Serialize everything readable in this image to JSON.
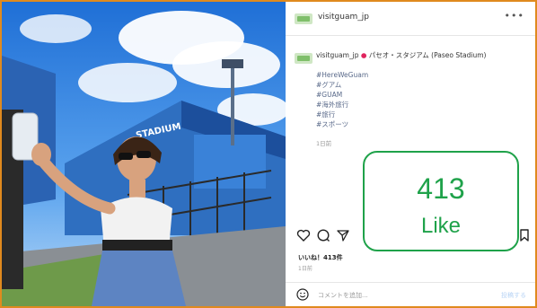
{
  "post": {
    "username": "visitguam_jp",
    "more_icon": "ellipsis-icon",
    "caption_user": "visitguam_jp",
    "caption_location": "パセオ・スタジアム (Paseo Stadium)",
    "hashtags": [
      "#HereWeGuam",
      "#グアム",
      "#GUAM",
      "#海外旅行",
      "#旅行",
      "#スポーツ"
    ],
    "time_ago": "1日前",
    "photo_sign": "STADIUM",
    "likes_text": "いいね！413件",
    "date_text": "1日前",
    "comment_placeholder": "コメントを追加...",
    "post_button": "投稿する"
  },
  "overlay": {
    "like_count": "413",
    "like_label": "Like",
    "accent_color": "#1fa24a"
  },
  "icons": [
    "heart-icon",
    "comment-icon",
    "share-icon",
    "bookmark-icon",
    "emoji-icon"
  ],
  "colors": {
    "frame": "#e08a1e",
    "stadium_blue": "#2f6fc0"
  }
}
